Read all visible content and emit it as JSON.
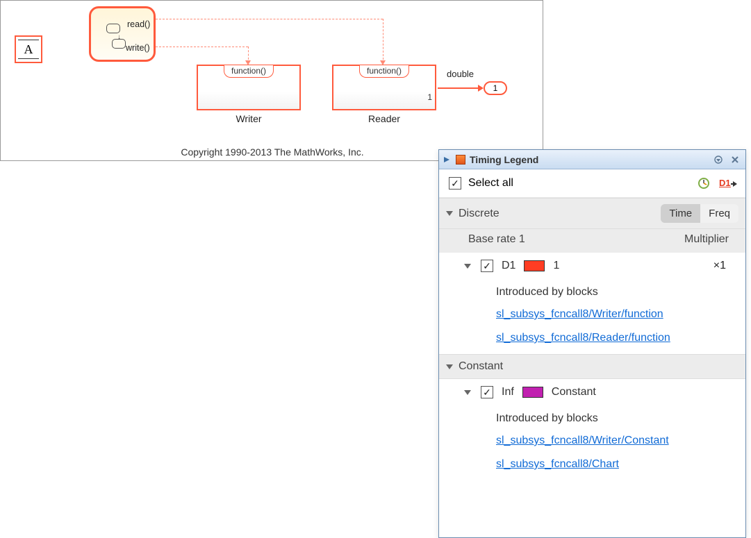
{
  "canvas": {
    "block_a_label": "A",
    "chart": {
      "read_label": "read()",
      "write_label": "write()"
    },
    "writer": {
      "top": "function()",
      "name": "Writer"
    },
    "reader": {
      "top": "function()",
      "name": "Reader",
      "out_port": "1"
    },
    "signal_type": "double",
    "outport": {
      "number": "1"
    },
    "copyright": "Copyright 1990-2013 The MathWorks, Inc."
  },
  "panel": {
    "title": "Timing Legend",
    "select_all": "Select all",
    "toggle": {
      "time": "Time",
      "freq": "Freq"
    },
    "discrete": {
      "label": "Discrete",
      "base_rate_label": "Base rate 1",
      "multiplier_label": "Multiplier",
      "rate": {
        "name": "D1",
        "value": "1",
        "multiplier": "×1"
      },
      "intro": "Introduced by blocks",
      "links": [
        "sl_subsys_fcncall8/Writer/function",
        "sl_subsys_fcncall8/Reader/function"
      ]
    },
    "constant": {
      "label": "Constant",
      "rate": {
        "name": "Inf",
        "value": "Constant"
      },
      "intro": "Introduced by blocks",
      "links": [
        "sl_subsys_fcncall8/Writer/Constant",
        "sl_subsys_fcncall8/Chart"
      ]
    }
  }
}
